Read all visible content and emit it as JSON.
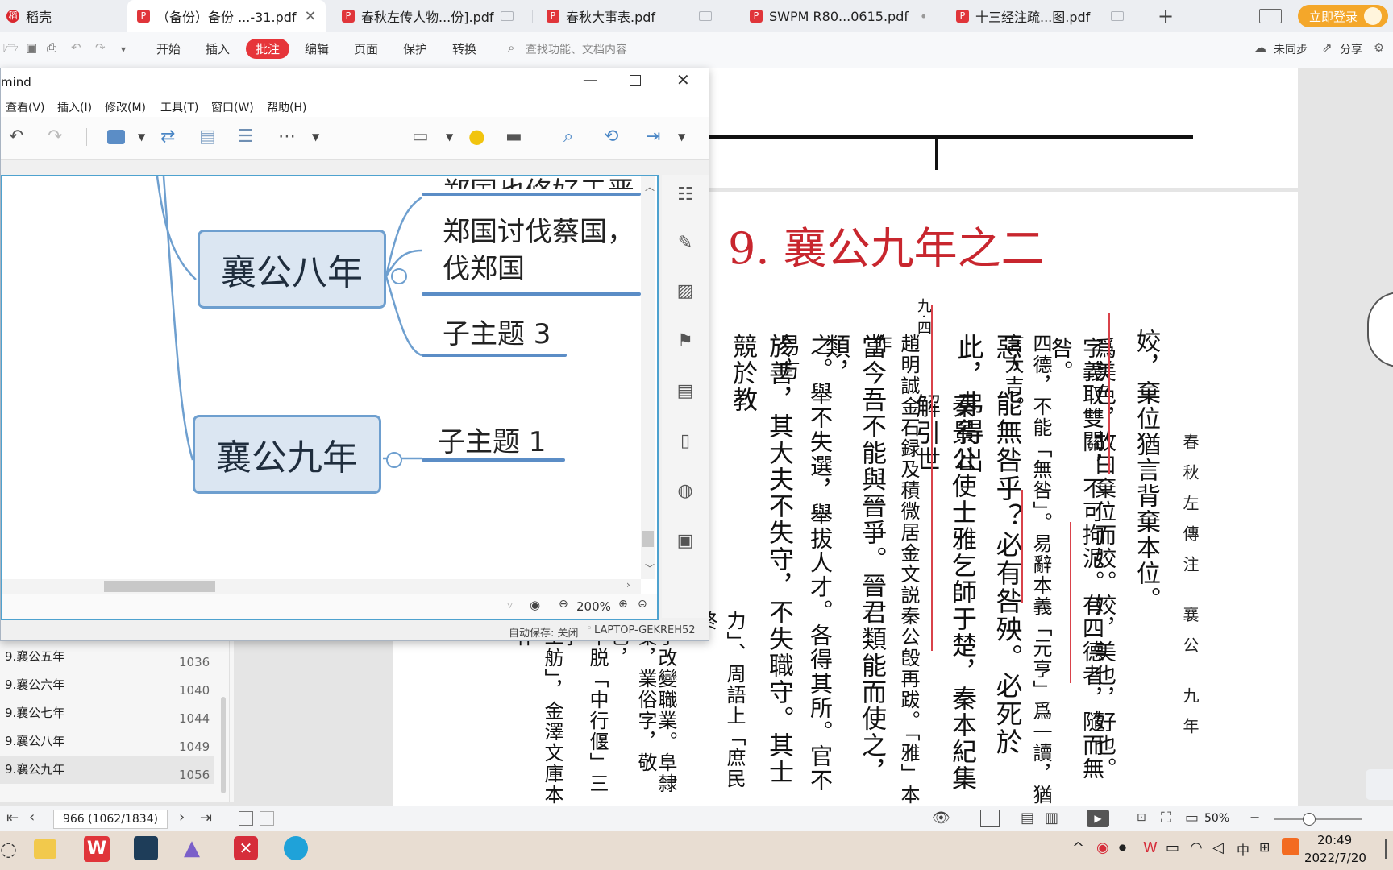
{
  "tabs": {
    "home": "稻壳",
    "t1": "（备份）备份 ...-31.pdf",
    "t2": "春秋左传人物...份].pdf",
    "t3": "春秋大事表.pdf",
    "t4": "SWPM R80...0615.pdf",
    "t5": "十三经注疏...图.pdf",
    "new_tab": "+",
    "login": "立即登录"
  },
  "ribbon": {
    "items": [
      "开始",
      "插入",
      "批注",
      "编辑",
      "页面",
      "保护",
      "转换"
    ],
    "search_placeholder": "查找功能、文档内容",
    "sync": "未同步",
    "share": "分享"
  },
  "xmind": {
    "title": "mind",
    "menu": [
      "查看(V)",
      "插入(I)",
      "修改(M)",
      "工具(T)",
      "窗口(W)",
      "帮助(H)"
    ],
    "topics": {
      "t8": "襄公八年",
      "t9": "襄公九年",
      "partial_top": "郑国也修好于晋,",
      "sub_a_line1": "郑国讨伐蔡国，",
      "sub_a_line2": "伐郑国",
      "sub_b": "子主题 3",
      "sub_c": "子主题 1"
    },
    "zoom": "200%",
    "autosave": "自动保存: 关闭",
    "computer": "LAPTOP-GEKREH52"
  },
  "chapters": [
    {
      "name": "9.襄公五年",
      "page": "1036"
    },
    {
      "name": "9.襄公六年",
      "page": "1040"
    },
    {
      "name": "9.襄公七年",
      "page": "1044"
    },
    {
      "name": "9.襄公八年",
      "page": "1049"
    },
    {
      "name": "9.襄公九年",
      "page": "1056"
    }
  ],
  "doc": {
    "heading": "9. 襄公九年之二",
    "running_head": "春秋左傳注 襄公 九年",
    "columns": [
      "姣，棄位猶言背棄本位。",
      "爲美色，故曰棄位而姣。姣，美也，好也。",
      "字義取雙關，不可拘泥。有四德者，隨而無咎。",
      "四德，不能「無咎」。易辭本義「元亨」爲一讀，猶言大吉。",
      "惡，能無咎乎？必有咎殃。必死於此，弗得出",
      "秦景公使士雅乞師于楚，秦本紀集解引世",
      "趙明誠金石録及積微居金文説秦公𣪘再跋。「雅」本作",
      "當今吾不能與晉爭。晉君類能而使之，類，",
      "之。舉不失選，舉拔人才。各得其所。官不易方",
      "於善，其大夫不失守，不失職守。其士競於教"
    ],
    "bottom_cols": [
      "力」、周語上「庶民終",
      "于改變職業。阜隸",
      "業，業俗字，敬也，",
      "下脱「中行偃」三字",
      "工舫」，金澤文庫本作"
    ],
    "side_mark": "九·四"
  },
  "navbar": {
    "page_indicator": "966 (1062/1834)",
    "zoom": "50%"
  },
  "clock": {
    "time": "20:49",
    "date": "2022/7/20"
  },
  "colors": {
    "accent_red": "#e6353a",
    "heading_red": "#c8262e",
    "xmind_border": "#4ea2cf",
    "topic_fill": "#dbe6f2"
  }
}
